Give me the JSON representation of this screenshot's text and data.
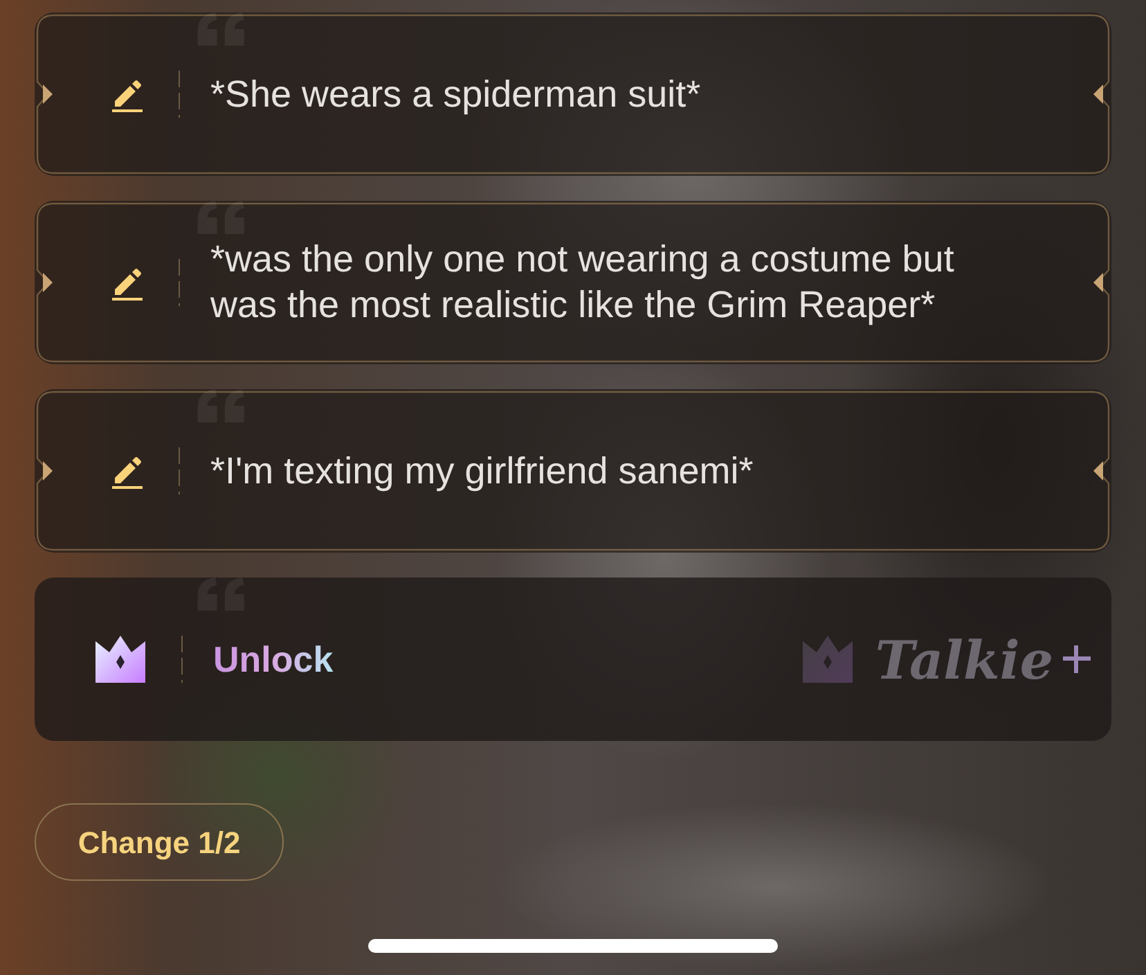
{
  "suggestions": [
    {
      "text": "*She wears a spiderman suit*"
    },
    {
      "text": "*was the only one not wearing a costume but was the most realistic like the Grim Reaper*"
    },
    {
      "text": "*I'm texting my girlfriend sanemi*"
    }
  ],
  "unlock": {
    "label": "Unlock",
    "brand": "Talkie"
  },
  "change_button": {
    "label": "Change 1/2"
  }
}
